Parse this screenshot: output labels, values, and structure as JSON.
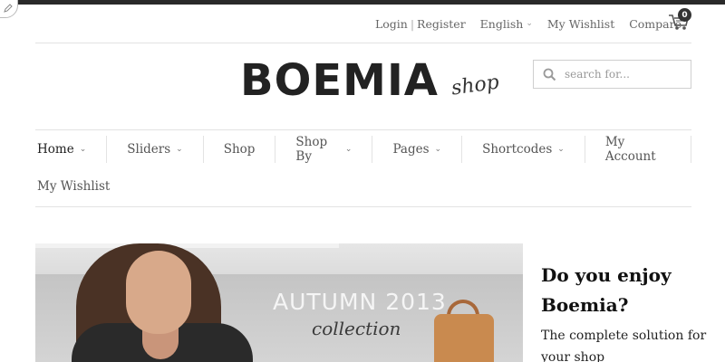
{
  "topbar": {
    "login": "Login",
    "register": "Register",
    "language": "English",
    "wishlist": "My Wishlist",
    "compare": "Compare",
    "cart_count": "0"
  },
  "logo": {
    "main": "BOEMIA",
    "sub": "shop"
  },
  "search": {
    "placeholder": "search for..."
  },
  "nav": {
    "items": [
      {
        "label": "Home"
      },
      {
        "label": "Sliders"
      },
      {
        "label": "Shop"
      },
      {
        "label": "Shop By"
      },
      {
        "label": "Pages"
      },
      {
        "label": "Shortcodes"
      },
      {
        "label": "My Account"
      },
      {
        "label": "My Wishlist"
      }
    ]
  },
  "banner": {
    "title": "AUTUMN 2013",
    "subtitle": "collection"
  },
  "side": {
    "title": "Do you enjoy Boemia?",
    "text": "The complete solution for your shop"
  }
}
